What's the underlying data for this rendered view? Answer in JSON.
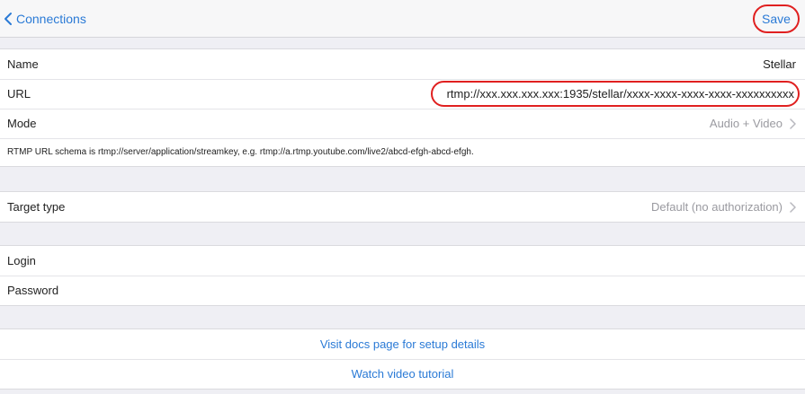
{
  "navbar": {
    "back_label": "Connections",
    "back_icon": "chevron-left-icon",
    "save_label": "Save",
    "accent_color": "#2a7ad6",
    "highlight_color": "#e02020"
  },
  "connection": {
    "name_label": "Name",
    "name_value": "Stellar",
    "url_label": "URL",
    "url_value": "rtmp://xxx.xxx.xxx.xxx:1935/stellar/xxxx-xxxx-xxxx-xxxx-xxxxxxxxxx",
    "mode_label": "Mode",
    "mode_value": "Audio + Video",
    "schema_note": "RTMP URL schema is rtmp://server/application/streamkey, e.g. rtmp://a.rtmp.youtube.com/live2/abcd-efgh-abcd-efgh."
  },
  "target": {
    "label": "Target type",
    "value": "Default (no authorization)"
  },
  "credentials": {
    "login_label": "Login",
    "password_label": "Password"
  },
  "links": {
    "docs": "Visit docs page for setup details",
    "video": "Watch video tutorial"
  }
}
